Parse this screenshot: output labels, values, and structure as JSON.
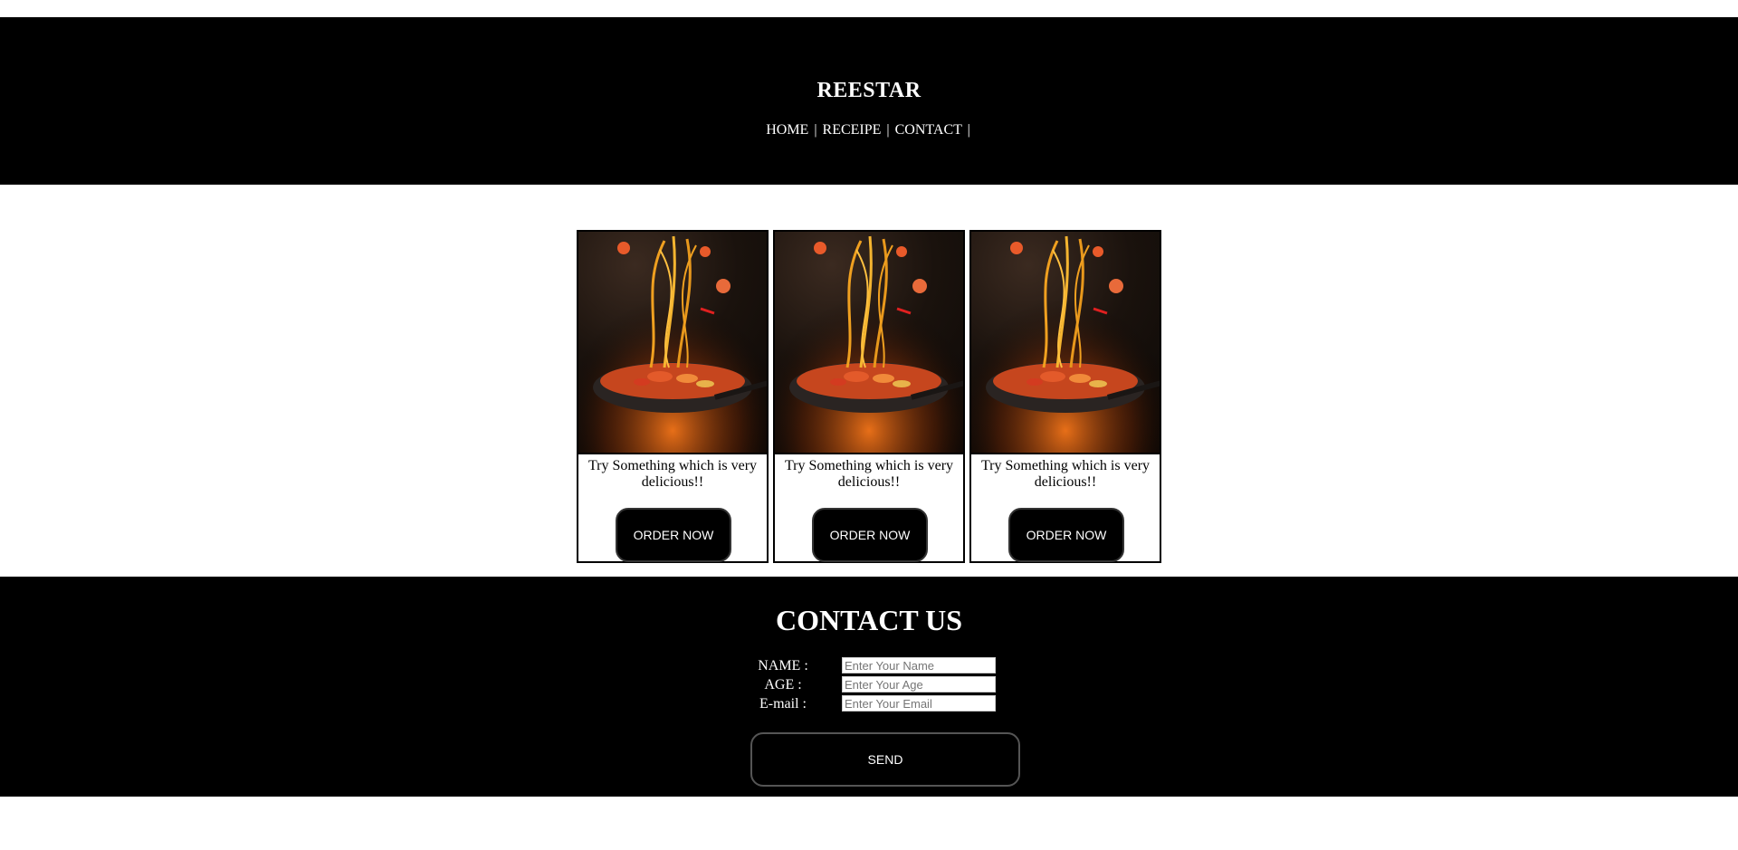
{
  "header": {
    "brand": "REESTAR",
    "nav": [
      {
        "label": "HOME"
      },
      {
        "label": "RECEIPE"
      },
      {
        "label": "CONTACT"
      }
    ],
    "separator": "|"
  },
  "cards": [
    {
      "image": "pasta-pan-image",
      "text": "Try Something which is very delicious!!",
      "button": "ORDER NOW"
    },
    {
      "image": "pasta-pan-image",
      "text": "Try Something which is very delicious!!",
      "button": "ORDER NOW"
    },
    {
      "image": "pasta-pan-image",
      "text": "Try Something which is very delicious!!",
      "button": "ORDER NOW"
    }
  ],
  "contact": {
    "title": "CONTACT US",
    "fields": [
      {
        "label": "NAME :",
        "placeholder": "Enter Your Name",
        "value": ""
      },
      {
        "label": "AGE :",
        "placeholder": "Enter Your Age",
        "value": ""
      },
      {
        "label": "E-mail :",
        "placeholder": "Enter Your Email",
        "value": ""
      }
    ],
    "send_label": "SEND"
  },
  "colors": {
    "background": "#ffffff",
    "header_bg": "#000000",
    "text_light": "#ffffff"
  }
}
